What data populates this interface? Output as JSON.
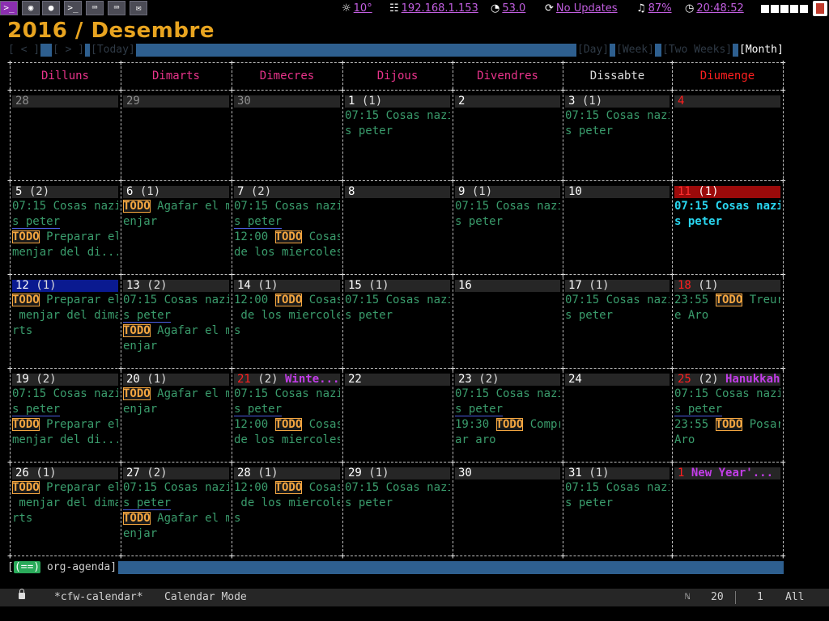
{
  "topbar": {
    "icons": [
      "terminal-icon",
      "globe-icon",
      "chat-icon",
      "console-icon",
      "keyboard-icon",
      "keyboard-icon",
      "mail-icon"
    ],
    "weather": "10°",
    "ip": "192.168.1.153",
    "speed": "53.0",
    "updates": "No Updates",
    "volume": "87%",
    "clock": "20:48:52"
  },
  "title": "2016 / Desembre",
  "nav": {
    "prev": "[ < ]",
    "next": "[ > ]",
    "today": "[Today]",
    "day": "[Day]",
    "week": "[Week]",
    "two_weeks": "[Two Weeks]",
    "month": "[Month]"
  },
  "weekdays": [
    "Dilluns",
    "Dimarts",
    "Dimecres",
    "Dijous",
    "Divendres",
    "Dissabte",
    "Diumenge"
  ],
  "colors": {
    "weekday": "#e8338a",
    "saturday": "#dcdcdc",
    "sunday": "#ff1f1f",
    "event": "#3a9c6c",
    "todo": "#f4a640",
    "title": "#e8a420",
    "bar": "#2e5f8f"
  },
  "weeks": [
    [
      {
        "day": "28",
        "count": "",
        "style": "dim",
        "lines": []
      },
      {
        "day": "29",
        "count": "",
        "style": "dim",
        "lines": []
      },
      {
        "day": "30",
        "count": "",
        "style": "dim",
        "lines": []
      },
      {
        "day": "1",
        "count": "(1)",
        "style": "",
        "lines": [
          [
            {
              "t": "07:15 Cosas nazi"
            }
          ],
          [
            {
              "t": "s peter"
            }
          ]
        ]
      },
      {
        "day": "2",
        "count": "",
        "style": "",
        "lines": []
      },
      {
        "day": "3",
        "count": "(1)",
        "style": "",
        "lines": [
          [
            {
              "t": "07:15 Cosas nazi"
            }
          ],
          [
            {
              "t": "s peter"
            }
          ]
        ]
      },
      {
        "day": "4",
        "count": "",
        "style": "hol",
        "lines": []
      }
    ],
    [
      {
        "day": "5",
        "count": "(2)",
        "style": "",
        "lines": [
          [
            {
              "t": "07:15 Cosas nazi"
            }
          ],
          [
            {
              "t": "s peter",
              "ul": true
            }
          ],
          [
            {
              "t": "TODO",
              "todo": true
            },
            {
              "t": " Preparar el"
            }
          ],
          [
            {
              "t": "menjar del di..."
            }
          ]
        ]
      },
      {
        "day": "6",
        "count": "(1)",
        "style": "",
        "lines": [
          [
            {
              "t": "TODO",
              "todo": true
            },
            {
              "t": " Agafar el m"
            }
          ],
          [
            {
              "t": "enjar"
            }
          ]
        ]
      },
      {
        "day": "7",
        "count": "(2)",
        "style": "",
        "lines": [
          [
            {
              "t": "07:15 Cosas nazi"
            }
          ],
          [
            {
              "t": "s peter",
              "ul": true
            }
          ],
          [
            {
              "t": "12:00 "
            },
            {
              "t": "TODO",
              "todo": true
            },
            {
              "t": " Cosas"
            }
          ],
          [
            {
              "t": "de los miercoles"
            }
          ]
        ]
      },
      {
        "day": "8",
        "count": "",
        "style": "",
        "lines": []
      },
      {
        "day": "9",
        "count": "(1)",
        "style": "",
        "lines": [
          [
            {
              "t": "07:15 Cosas nazi"
            }
          ],
          [
            {
              "t": "s peter"
            }
          ]
        ]
      },
      {
        "day": "10",
        "count": "",
        "style": "",
        "lines": []
      },
      {
        "day": "11",
        "count": "(1)",
        "style": "today",
        "lines": [
          [
            {
              "t": "07:15 Cosas nazi",
              "cur": true
            }
          ],
          [
            {
              "t": "s peter",
              "cur": true
            }
          ]
        ]
      }
    ],
    [
      {
        "day": "12",
        "count": "(1)",
        "style": "sel",
        "lines": [
          [
            {
              "t": "TODO",
              "todo": true
            },
            {
              "t": " Preparar el"
            }
          ],
          [
            {
              "t": " menjar del dima"
            }
          ],
          [
            {
              "t": "rts"
            }
          ]
        ]
      },
      {
        "day": "13",
        "count": "(2)",
        "style": "",
        "lines": [
          [
            {
              "t": "07:15 Cosas nazi"
            }
          ],
          [
            {
              "t": "s peter",
              "ul": true
            }
          ],
          [
            {
              "t": "TODO",
              "todo": true
            },
            {
              "t": " Agafar el m"
            }
          ],
          [
            {
              "t": "enjar"
            }
          ]
        ]
      },
      {
        "day": "14",
        "count": "(1)",
        "style": "",
        "lines": [
          [
            {
              "t": "12:00 "
            },
            {
              "t": "TODO",
              "todo": true
            },
            {
              "t": " Cosas"
            }
          ],
          [
            {
              "t": " de los miercole"
            }
          ],
          [
            {
              "t": "s"
            }
          ]
        ]
      },
      {
        "day": "15",
        "count": "(1)",
        "style": "",
        "lines": [
          [
            {
              "t": "07:15 Cosas nazi"
            }
          ],
          [
            {
              "t": "s peter"
            }
          ]
        ]
      },
      {
        "day": "16",
        "count": "",
        "style": "",
        "lines": []
      },
      {
        "day": "17",
        "count": "(1)",
        "style": "",
        "lines": [
          [
            {
              "t": "07:15 Cosas nazi"
            }
          ],
          [
            {
              "t": "s peter"
            }
          ]
        ]
      },
      {
        "day": "18",
        "count": "(1)",
        "style": "hol",
        "lines": [
          [
            {
              "t": "23:55 "
            },
            {
              "t": "TODO",
              "todo": true
            },
            {
              "t": " Treur"
            }
          ],
          [
            {
              "t": "e Aro"
            }
          ]
        ]
      }
    ],
    [
      {
        "day": "19",
        "count": "(2)",
        "style": "",
        "lines": [
          [
            {
              "t": "07:15 Cosas nazi"
            }
          ],
          [
            {
              "t": "s peter",
              "ul": true
            }
          ],
          [
            {
              "t": "TODO",
              "todo": true
            },
            {
              "t": " Preparar el"
            }
          ],
          [
            {
              "t": "menjar del di..."
            }
          ]
        ]
      },
      {
        "day": "20",
        "count": "(1)",
        "style": "",
        "lines": [
          [
            {
              "t": "TODO",
              "todo": true
            },
            {
              "t": " Agafar el m"
            }
          ],
          [
            {
              "t": "enjar"
            }
          ]
        ]
      },
      {
        "day": "21",
        "count": "(2)",
        "style": "hol",
        "holiday": "Winte...",
        "lines": [
          [
            {
              "t": "07:15 Cosas nazi"
            }
          ],
          [
            {
              "t": "s peter",
              "ul": true
            }
          ],
          [
            {
              "t": "12:00 "
            },
            {
              "t": "TODO",
              "todo": true
            },
            {
              "t": " Cosas"
            }
          ],
          [
            {
              "t": "de los miercoles"
            }
          ]
        ]
      },
      {
        "day": "22",
        "count": "",
        "style": "",
        "lines": []
      },
      {
        "day": "23",
        "count": "(2)",
        "style": "",
        "lines": [
          [
            {
              "t": "07:15 Cosas nazi"
            }
          ],
          [
            {
              "t": "s peter",
              "ul": true
            }
          ],
          [
            {
              "t": "19:30 "
            },
            {
              "t": "TODO",
              "todo": true
            },
            {
              "t": " Compr"
            }
          ],
          [
            {
              "t": "ar aro"
            }
          ]
        ]
      },
      {
        "day": "24",
        "count": "",
        "style": "",
        "lines": []
      },
      {
        "day": "25",
        "count": "(2)",
        "style": "hol",
        "holiday": "Hanukkah",
        "lines": [
          [
            {
              "t": "07:15 Cosas nazi"
            }
          ],
          [
            {
              "t": "s peter",
              "ul": true
            }
          ],
          [
            {
              "t": "23:55 "
            },
            {
              "t": "TODO",
              "todo": true
            },
            {
              "t": " Posar"
            }
          ],
          [
            {
              "t": "Aro"
            }
          ]
        ]
      }
    ],
    [
      {
        "day": "26",
        "count": "(1)",
        "style": "",
        "lines": [
          [
            {
              "t": "TODO",
              "todo": true
            },
            {
              "t": " Preparar el"
            }
          ],
          [
            {
              "t": " menjar del dima"
            }
          ],
          [
            {
              "t": "rts"
            }
          ]
        ]
      },
      {
        "day": "27",
        "count": "(2)",
        "style": "",
        "lines": [
          [
            {
              "t": "07:15 Cosas nazi"
            }
          ],
          [
            {
              "t": "s peter",
              "ul": true
            }
          ],
          [
            {
              "t": "TODO",
              "todo": true
            },
            {
              "t": " Agafar el m"
            }
          ],
          [
            {
              "t": "enjar"
            }
          ]
        ]
      },
      {
        "day": "28",
        "count": "(1)",
        "style": "",
        "lines": [
          [
            {
              "t": "12:00 "
            },
            {
              "t": "TODO",
              "todo": true
            },
            {
              "t": " Cosas"
            }
          ],
          [
            {
              "t": " de los miercole"
            }
          ],
          [
            {
              "t": "s"
            }
          ]
        ]
      },
      {
        "day": "29",
        "count": "(1)",
        "style": "",
        "lines": [
          [
            {
              "t": "07:15 Cosas nazi"
            }
          ],
          [
            {
              "t": "s peter"
            }
          ]
        ]
      },
      {
        "day": "30",
        "count": "",
        "style": "",
        "lines": []
      },
      {
        "day": "31",
        "count": "(1)",
        "style": "",
        "lines": [
          [
            {
              "t": "07:15 Cosas nazi"
            }
          ],
          [
            {
              "t": "s peter"
            }
          ]
        ]
      },
      {
        "day": "1",
        "count": "",
        "style": "hol",
        "holiday": "New Year'...",
        "lines": []
      }
    ]
  ],
  "footer": {
    "badge": "(==)",
    "label": "org-agenda]"
  },
  "modeline": {
    "buffer": "*cfw-calendar*",
    "mode": "Calendar Mode",
    "line": "20",
    "col": "1",
    "position": "All"
  }
}
